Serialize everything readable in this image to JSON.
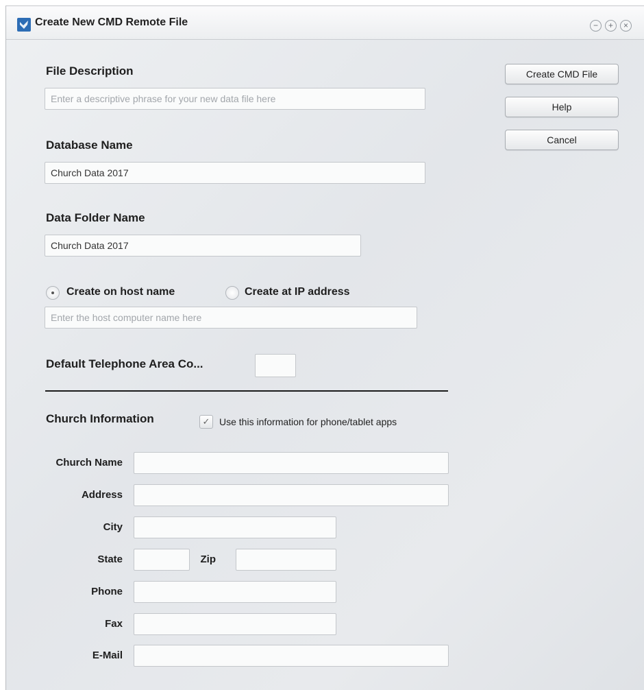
{
  "window": {
    "title": "Create New CMD Remote File",
    "controls": {
      "minimize": "−",
      "maximize": "+",
      "close": "×"
    }
  },
  "buttons": {
    "create": "Create CMD File",
    "help": "Help",
    "cancel": "Cancel"
  },
  "file_description": {
    "label": "File Description",
    "placeholder": "Enter a descriptive phrase for your new data file here",
    "value": ""
  },
  "database_name": {
    "label": "Database Name",
    "value": "Church Data 2017"
  },
  "data_folder_name": {
    "label": "Data Folder Name",
    "value": "Church Data 2017"
  },
  "host": {
    "option_host": "Create on host name",
    "option_ip": "Create at IP address",
    "selected": "Create on host name",
    "placeholder": "Enter the host computer name here",
    "value": ""
  },
  "area_code": {
    "label": "Default Telephone Area Co...",
    "value": ""
  },
  "church_info": {
    "heading": "Church Information",
    "checkbox_label": "Use this information for phone/tablet apps",
    "checkbox_checked": true,
    "check_glyph": "✓",
    "fields": {
      "church_name": {
        "label": "Church Name",
        "value": ""
      },
      "address": {
        "label": "Address",
        "value": ""
      },
      "city": {
        "label": "City",
        "value": ""
      },
      "state": {
        "label": "State",
        "value": ""
      },
      "zip": {
        "label": "Zip",
        "value": ""
      },
      "phone": {
        "label": "Phone",
        "value": ""
      },
      "fax": {
        "label": "Fax",
        "value": ""
      },
      "email": {
        "label": "E-Mail",
        "value": ""
      }
    }
  },
  "colors": {
    "app_icon": "#2d6db5",
    "divider": "#1b1b1b"
  }
}
